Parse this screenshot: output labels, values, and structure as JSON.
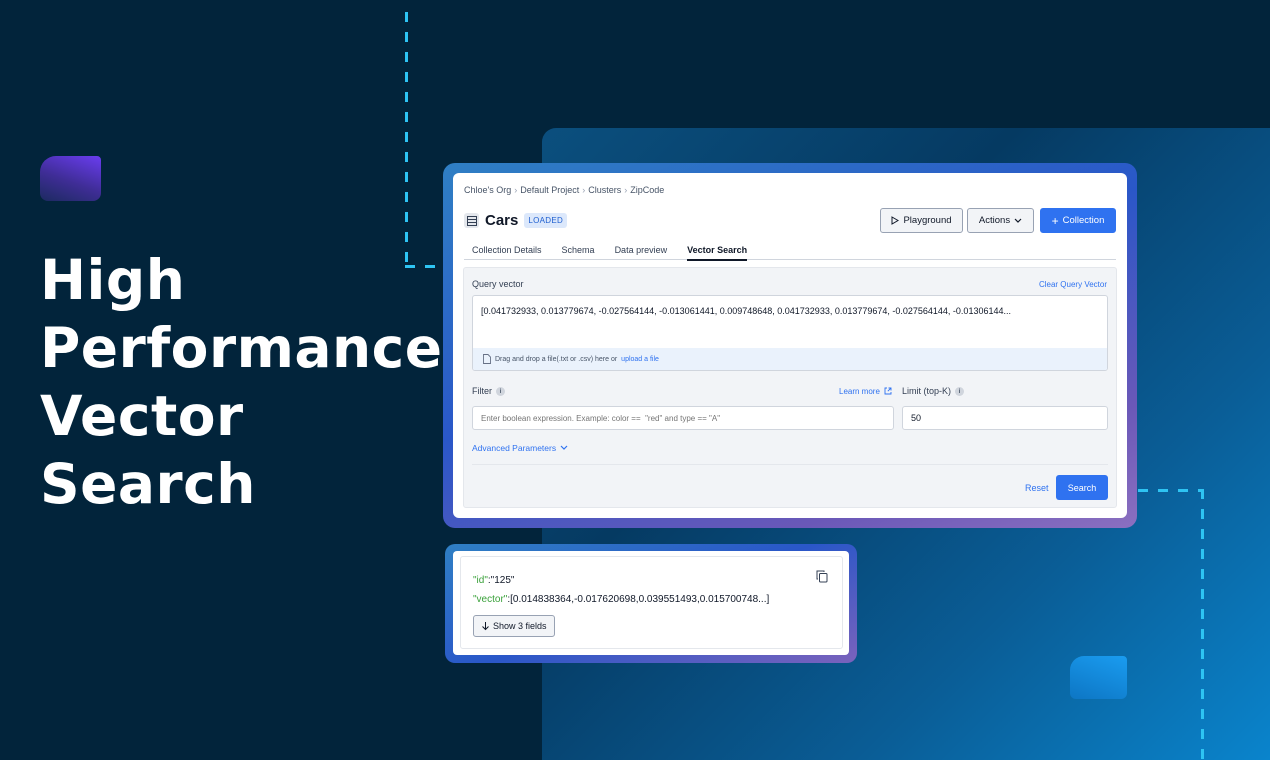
{
  "hero": {
    "lines": [
      "High",
      "Performance",
      "Vector",
      "Search"
    ]
  },
  "colors": {
    "accent": "#2f72f0",
    "background": "#02243b",
    "dash": "#2ec4f3",
    "json_key": "#3aa13a"
  },
  "window": {
    "breadcrumb": [
      "Chloe's Org",
      "Default Project",
      "Clusters",
      "ZipCode"
    ],
    "title": "Cars",
    "status": "LOADED",
    "buttons": {
      "playground": "Playground",
      "actions": "Actions",
      "collection": "Collection"
    },
    "tabs": [
      "Collection Details",
      "Schema",
      "Data preview",
      "Vector Search"
    ],
    "active_tab": "Vector Search",
    "query": {
      "label": "Query vector",
      "clear_label": "Clear Query Vector",
      "value": "[0.041732933, 0.013779674, -0.027564144, -0.013061441, 0.009748648, 0.041732933, 0.013779674, -0.027564144, -0.01306144...",
      "drop_text": "Drag and drop a file(.txt or .csv) here or",
      "upload_link": "upload a file"
    },
    "filter": {
      "label": "Filter",
      "learn_more": "Learn more",
      "placeholder": "Enter boolean expression. Example: color ==  \"red\" and type == \"A\""
    },
    "limit": {
      "label": "Limit (top-K)",
      "value": "50"
    },
    "advanced": "Advanced Parameters",
    "reset": "Reset",
    "search": "Search"
  },
  "result": {
    "id_key": "\"id\"",
    "id_value": ":\"125\"",
    "vector_key": "\"vector\"",
    "vector_value": ":[0.014838364,-0.017620698,0.039551493,0.015700748...]",
    "show_fields": "Show 3 fields"
  }
}
